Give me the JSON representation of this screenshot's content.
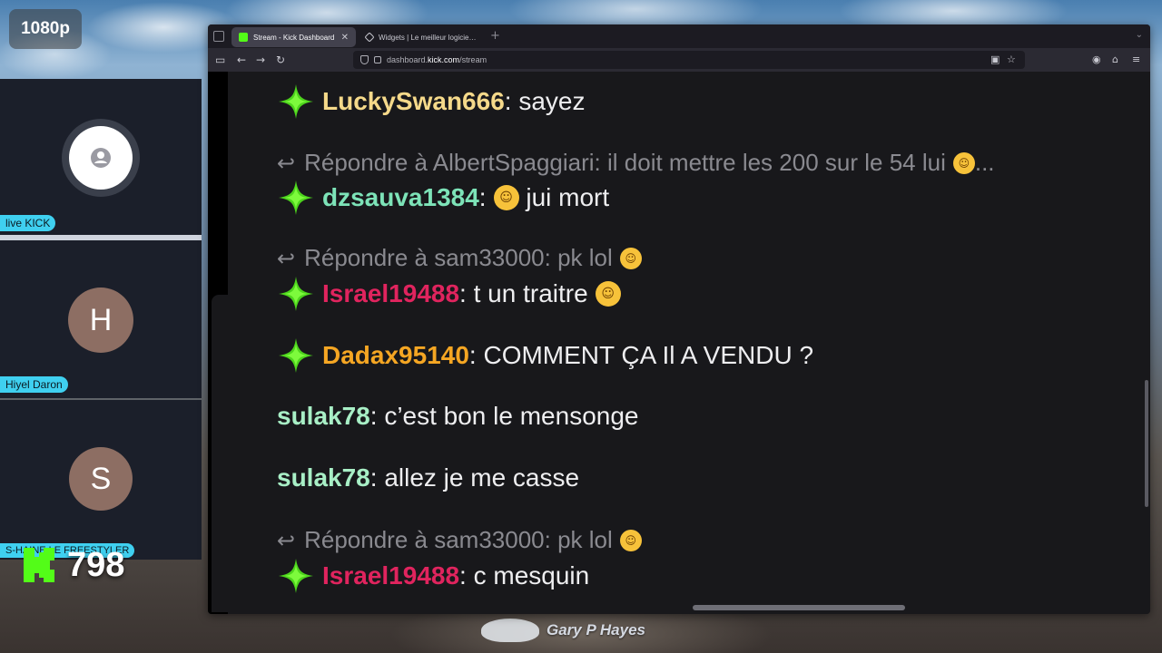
{
  "overlay": {
    "quality": "1080p",
    "follower_count": "798",
    "watermark_text": "Gary P Hayes"
  },
  "participants": [
    {
      "name": "live KICK",
      "avatar": "person-icon"
    },
    {
      "name": "Hiyel Daron",
      "avatar_letter": "H"
    },
    {
      "name": "S-HAINE LE FREESTYLER",
      "avatar_letter": "S"
    }
  ],
  "browser": {
    "tabs": [
      {
        "title": "Stream - Kick Dashboard",
        "active": true
      },
      {
        "title": "Widgets | Le meilleur logiciel po",
        "active": false
      }
    ],
    "url_prefix": "dashboard.",
    "url_host": "kick.com",
    "url_path": "/stream"
  },
  "chat": {
    "messages": [
      {
        "type": "message",
        "badge": true,
        "user": "LuckySwan666",
        "color": "#f5d98a",
        "text": "sayez",
        "emoji": null
      },
      {
        "type": "reply",
        "text": "Répondre à AlbertSpaggiari: il doit mettre les 200 sur le 54 lui",
        "emoji": "rofl",
        "suffix": " ..."
      },
      {
        "type": "message",
        "badge": true,
        "user": "dzsauva1384",
        "color": "#7de3b8",
        "text": " jui mort",
        "emoji_before": "joy"
      },
      {
        "type": "reply",
        "text": "Répondre à sam33000: pk lol",
        "emoji": "rofl",
        "suffix": ""
      },
      {
        "type": "message",
        "badge": true,
        "user": "Israel19488",
        "color": "#e0245e",
        "text": "t un traitre",
        "emoji": "joy"
      },
      {
        "type": "message",
        "badge": true,
        "user": "Dadax95140",
        "color": "#f5a623",
        "text": "COMMENT ÇA Il A VENDU ?",
        "emoji": null
      },
      {
        "type": "message",
        "badge": false,
        "user": "sulak78",
        "color": "#a8efc6",
        "text": "c’est bon le mensonge",
        "emoji": null
      },
      {
        "type": "message",
        "badge": false,
        "user": "sulak78",
        "color": "#a8efc6",
        "text": "allez je me casse",
        "emoji": null
      },
      {
        "type": "reply",
        "text": "Répondre à sam33000: pk lol",
        "emoji": "rofl",
        "suffix": ""
      },
      {
        "type": "message",
        "badge": true,
        "user": "Israel19488",
        "color": "#e0245e",
        "text": "c mesquin",
        "emoji": null
      }
    ]
  },
  "colors": {
    "kick_green": "#53fc18",
    "name_tag": "#3fd0f0"
  }
}
